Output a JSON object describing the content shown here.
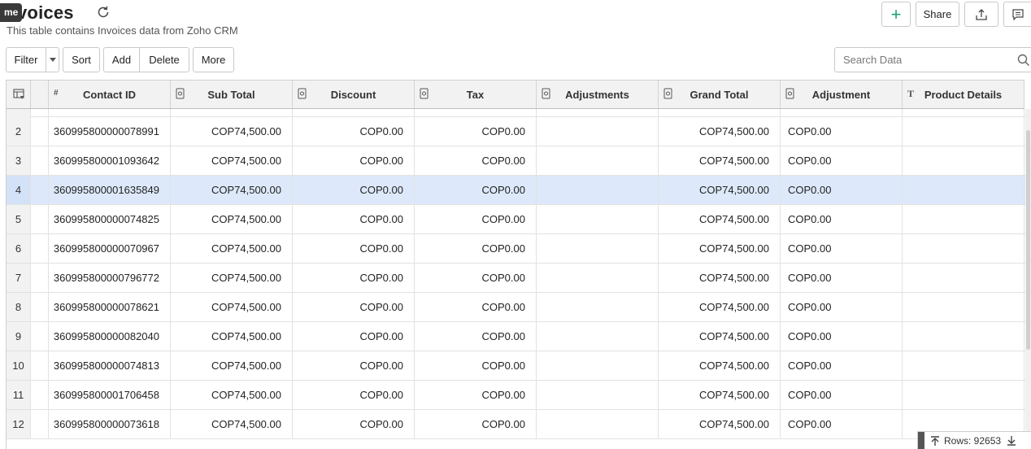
{
  "header": {
    "tooltip": "me",
    "title": "voices",
    "subtitle": "This table contains Invoices data from Zoho CRM",
    "share_label": "Share",
    "add_symbol": "+"
  },
  "toolbar": {
    "filter_label": "Filter",
    "sort_label": "Sort",
    "add_label": "Add",
    "delete_label": "Delete",
    "more_label": "More"
  },
  "search": {
    "placeholder": "Search Data"
  },
  "table": {
    "columns": [
      {
        "label": "",
        "type_icon": "table-settings-icon"
      },
      {
        "label": "",
        "type_icon": "#"
      },
      {
        "label": "Contact ID",
        "type_icon": ""
      },
      {
        "label": "Sub Total",
        "type_icon": "currency-type-icon"
      },
      {
        "label": "Discount",
        "type_icon": "currency-type-icon"
      },
      {
        "label": "Tax",
        "type_icon": "currency-type-icon"
      },
      {
        "label": "Adjustments",
        "type_icon": "currency-type-icon"
      },
      {
        "label": "Grand Total",
        "type_icon": "currency-type-icon"
      },
      {
        "label": "Adjustment",
        "type_icon": "currency-type-icon"
      },
      {
        "label": "Product Details",
        "type_icon": "T"
      }
    ],
    "rows": [
      {
        "num": "2",
        "contact_id": "360995800000078991",
        "sub_total": "COP74,500.00",
        "discount": "COP0.00",
        "tax": "COP0.00",
        "adjustments": "",
        "grand_total": "COP74,500.00",
        "adjustment": "COP0.00",
        "product_details": ""
      },
      {
        "num": "3",
        "contact_id": "360995800001093642",
        "sub_total": "COP74,500.00",
        "discount": "COP0.00",
        "tax": "COP0.00",
        "adjustments": "",
        "grand_total": "COP74,500.00",
        "adjustment": "COP0.00",
        "product_details": ""
      },
      {
        "num": "4",
        "contact_id": "360995800001635849",
        "sub_total": "COP74,500.00",
        "discount": "COP0.00",
        "tax": "COP0.00",
        "adjustments": "",
        "grand_total": "COP74,500.00",
        "adjustment": "COP0.00",
        "product_details": "",
        "selected": true
      },
      {
        "num": "5",
        "contact_id": "360995800000074825",
        "sub_total": "COP74,500.00",
        "discount": "COP0.00",
        "tax": "COP0.00",
        "adjustments": "",
        "grand_total": "COP74,500.00",
        "adjustment": "COP0.00",
        "product_details": ""
      },
      {
        "num": "6",
        "contact_id": "360995800000070967",
        "sub_total": "COP74,500.00",
        "discount": "COP0.00",
        "tax": "COP0.00",
        "adjustments": "",
        "grand_total": "COP74,500.00",
        "adjustment": "COP0.00",
        "product_details": ""
      },
      {
        "num": "7",
        "contact_id": "360995800000796772",
        "sub_total": "COP74,500.00",
        "discount": "COP0.00",
        "tax": "COP0.00",
        "adjustments": "",
        "grand_total": "COP74,500.00",
        "adjustment": "COP0.00",
        "product_details": ""
      },
      {
        "num": "8",
        "contact_id": "360995800000078621",
        "sub_total": "COP74,500.00",
        "discount": "COP0.00",
        "tax": "COP0.00",
        "adjustments": "",
        "grand_total": "COP74,500.00",
        "adjustment": "COP0.00",
        "product_details": ""
      },
      {
        "num": "9",
        "contact_id": "360995800000082040",
        "sub_total": "COP74,500.00",
        "discount": "COP0.00",
        "tax": "COP0.00",
        "adjustments": "",
        "grand_total": "COP74,500.00",
        "adjustment": "COP0.00",
        "product_details": ""
      },
      {
        "num": "10",
        "contact_id": "360995800000074813",
        "sub_total": "COP74,500.00",
        "discount": "COP0.00",
        "tax": "COP0.00",
        "adjustments": "",
        "grand_total": "COP74,500.00",
        "adjustment": "COP0.00",
        "product_details": ""
      },
      {
        "num": "11",
        "contact_id": "360995800001706458",
        "sub_total": "COP74,500.00",
        "discount": "COP0.00",
        "tax": "COP0.00",
        "adjustments": "",
        "grand_total": "COP74,500.00",
        "adjustment": "COP0.00",
        "product_details": ""
      },
      {
        "num": "12",
        "contact_id": "360995800000073618",
        "sub_total": "COP74,500.00",
        "discount": "COP0.00",
        "tax": "COP0.00",
        "adjustments": "",
        "grand_total": "COP74,500.00",
        "adjustment": "COP0.00",
        "product_details": ""
      }
    ]
  },
  "footer": {
    "rows_label": "Rows: 92653"
  },
  "colors": {
    "accent": "#1aa37a",
    "selected_row": "#dde9fa",
    "header_bg": "#f2f2f2"
  }
}
